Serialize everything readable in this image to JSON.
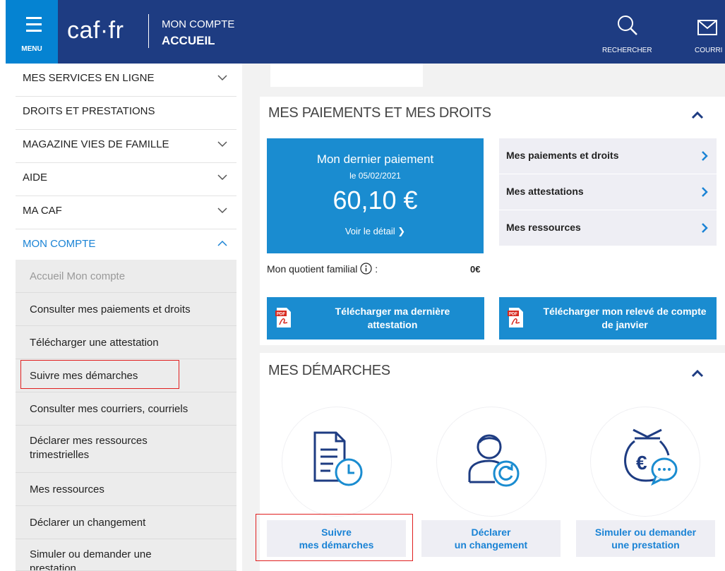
{
  "header": {
    "menu_label": "MENU",
    "logo": "caf·fr",
    "breadcrumb_top": "MON COMPTE",
    "breadcrumb_current": "ACCUEIL",
    "search_label": "RECHERCHER",
    "mail_label": "COURRI"
  },
  "sidebar": {
    "items": [
      {
        "label": "MES SERVICES EN LIGNE"
      },
      {
        "label": "DROITS ET PRESTATIONS"
      },
      {
        "label": "MAGAZINE VIES DE FAMILLE"
      },
      {
        "label": "AIDE"
      },
      {
        "label": "MA CAF"
      },
      {
        "label": "MON COMPTE"
      }
    ],
    "subitems": [
      {
        "label": "Accueil Mon compte"
      },
      {
        "label": "Consulter mes paiements et droits"
      },
      {
        "label": "Télécharger une attestation"
      },
      {
        "label": "Suivre mes démarches"
      },
      {
        "label": "Consulter mes courriers, courriels"
      },
      {
        "label": "Déclarer mes ressources trimestrielles"
      },
      {
        "label": "Mes ressources"
      },
      {
        "label": "Déclarer un changement"
      },
      {
        "label": "Simuler ou demander une prestation"
      }
    ]
  },
  "payments": {
    "title": "MES PAIEMENTS ET MES DROITS",
    "last_payment_label": "Mon dernier paiement",
    "last_payment_date": "le 05/02/2021",
    "last_payment_amount": "60,10 €",
    "detail_link": "Voir le détail ❯",
    "links": [
      {
        "label": "Mes paiements et droits"
      },
      {
        "label": "Mes attestations"
      },
      {
        "label": "Mes ressources"
      }
    ],
    "quotient_label": "Mon quotient familial",
    "quotient_colon": ":",
    "quotient_value": "0€",
    "download_attestation": "Télécharger ma dernière attestation",
    "download_statement": "Télécharger mon relevé de compte de janvier"
  },
  "demarches": {
    "title": "MES DÉMARCHES",
    "actions": [
      {
        "line1": "Suivre",
        "line2": "mes démarches",
        "icon": "document-clock-icon"
      },
      {
        "line1": "Déclarer",
        "line2": "un changement",
        "icon": "person-refresh-icon"
      },
      {
        "line1": "Simuler ou demander",
        "line2": "une prestation",
        "icon": "money-bag-chat-icon"
      }
    ]
  },
  "colors": {
    "header_bg": "#1e3c82",
    "menu_bg": "#0583d2",
    "accent_blue": "#1a8cd0",
    "link_blue": "#1a83d5",
    "highlight_red": "#e01f1f"
  }
}
